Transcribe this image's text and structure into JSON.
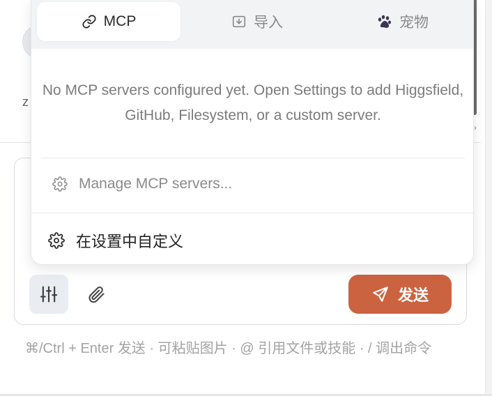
{
  "background": {
    "partial_letter": "z"
  },
  "popover": {
    "tabs": [
      {
        "label": "MCP",
        "icon": "link-icon",
        "active": true
      },
      {
        "label": "导入",
        "icon": "import-icon",
        "active": false
      },
      {
        "label": "宠物",
        "icon": "paw-icon",
        "active": false
      }
    ],
    "empty_message": "No MCP servers configured yet. Open Settings to add Higgsfield, GitHub, Filesystem, or a custom server.",
    "manage_label": "Manage MCP servers...",
    "customize_label": "在设置中自定义"
  },
  "composer": {
    "send_label": "发送",
    "hint": "⌘/Ctrl + Enter 发送 · 可粘贴图片 · @ 引用文件或技能 · / 调出命令"
  },
  "colors": {
    "accent": "#cc6340",
    "tabbar_bg": "#f1f3f5",
    "muted_text": "#7b7b7b"
  }
}
